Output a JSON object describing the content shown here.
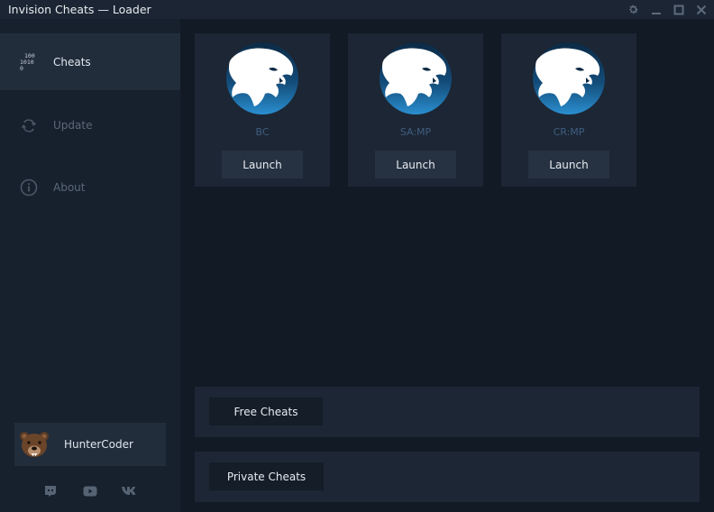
{
  "window": {
    "title": "Invision Cheats — Loader"
  },
  "sidebar": {
    "items": [
      {
        "label": "Cheats",
        "icon": "binary-code-icon",
        "active": true
      },
      {
        "label": "Update",
        "icon": "refresh-icon",
        "active": false
      },
      {
        "label": "About",
        "icon": "info-icon",
        "active": false
      }
    ],
    "user": {
      "name": "HunterCoder",
      "avatar": "bear-avatar"
    },
    "social": [
      "discord-icon",
      "youtube-icon",
      "vk-icon"
    ]
  },
  "games": [
    {
      "name": "BC",
      "button": "Launch",
      "icon": "panther-logo-icon"
    },
    {
      "name": "SA:MP",
      "button": "Launch",
      "icon": "panther-logo-icon"
    },
    {
      "name": "CR:MP",
      "button": "Launch",
      "icon": "panther-logo-icon"
    }
  ],
  "panels": {
    "free": {
      "label": "Free Cheats"
    },
    "private": {
      "label": "Private Cheats"
    }
  },
  "colors": {
    "background": "#111a25",
    "sidebar": "#17212d",
    "card": "#1c2634",
    "accent_blue": "#2a7fc0",
    "game_name": "#3f5d80"
  }
}
